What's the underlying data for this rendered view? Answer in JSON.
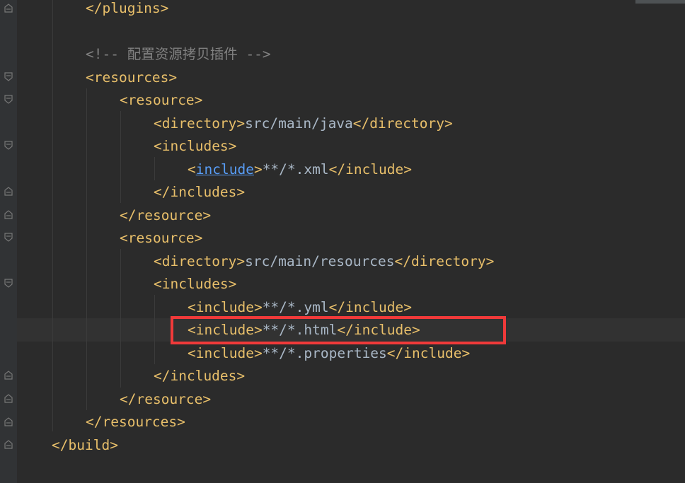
{
  "editor": {
    "lines": {
      "l1": {
        "open": "</",
        "name": "plugins",
        "close": ">"
      },
      "l3": {
        "comment": "<!-- 配置资源拷贝插件 -->"
      },
      "l4": {
        "open": "<",
        "name": "resources",
        "close": ">"
      },
      "l5": {
        "open": "<",
        "name": "resource",
        "close": ">"
      },
      "l6": {
        "open": "<",
        "name": "directory",
        "close": ">",
        "text": "src/main/java",
        "end_open": "</",
        "end_name": "directory",
        "end_close": ">"
      },
      "l7": {
        "open": "<",
        "name": "includes",
        "close": ">"
      },
      "l8": {
        "open": "<",
        "name": "include",
        "close": ">",
        "text": "**/*.xml",
        "end_open": "</",
        "end_name": "include",
        "end_close": ">"
      },
      "l9": {
        "open": "</",
        "name": "includes",
        "close": ">"
      },
      "l10": {
        "open": "</",
        "name": "resource",
        "close": ">"
      },
      "l11": {
        "open": "<",
        "name": "resource",
        "close": ">"
      },
      "l12": {
        "open": "<",
        "name": "directory",
        "close": ">",
        "text": "src/main/resources",
        "end_open": "</",
        "end_name": "directory",
        "end_close": ">"
      },
      "l13": {
        "open": "<",
        "name": "includes",
        "close": ">"
      },
      "l14": {
        "open": "<",
        "name": "include",
        "close": ">",
        "text": "**/*.yml",
        "end_open": "</",
        "end_name": "include",
        "end_close": ">"
      },
      "l15": {
        "open": "<",
        "name": "include",
        "close": ">",
        "text": "**/*.html",
        "end_open": "</",
        "end_name": "include",
        "end_close": ">"
      },
      "l16": {
        "open": "<",
        "name": "include",
        "close": ">",
        "text": "**/*.properties",
        "end_open": "</",
        "end_name": "include",
        "end_close": ">"
      },
      "l17": {
        "open": "</",
        "name": "includes",
        "close": ">"
      },
      "l18": {
        "open": "</",
        "name": "resource",
        "close": ">"
      },
      "l19": {
        "open": "</",
        "name": "resources",
        "close": ">"
      },
      "l20": {
        "open": "</",
        "name": "build",
        "close": ">"
      }
    }
  },
  "colors": {
    "background": "#2b2b2b",
    "tag": "#e8bf6a",
    "text": "#a9b7c6",
    "comment": "#808080",
    "link": "#589df6",
    "highlight_border": "#f03a3a"
  },
  "icons": {
    "fold_open": "fold-open-icon",
    "fold_close": "fold-close-icon"
  }
}
